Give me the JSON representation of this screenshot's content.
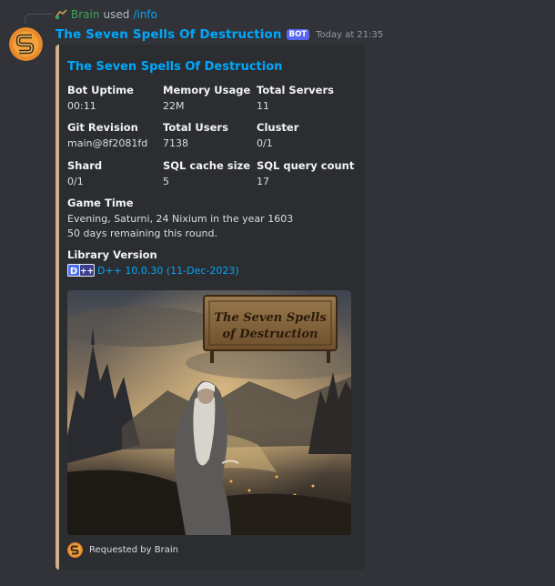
{
  "reply": {
    "user": "Brain",
    "used": "used",
    "command": "/info"
  },
  "message": {
    "username": "The Seven Spells Of Destruction",
    "bot_tag": "BOT",
    "timestamp": "Today at 21:35"
  },
  "embed": {
    "accent_color": "#ceb18a",
    "title": "The Seven Spells Of Destruction",
    "fields": [
      {
        "name": "Bot Uptime",
        "value": "00:11"
      },
      {
        "name": "Memory Usage",
        "value": "22M"
      },
      {
        "name": "Total Servers",
        "value": "11"
      },
      {
        "name": "Git Revision",
        "value": "main@8f2081fd"
      },
      {
        "name": "Total Users",
        "value": "7138"
      },
      {
        "name": "Cluster",
        "value": "0/1"
      },
      {
        "name": "Shard",
        "value": "0/1"
      },
      {
        "name": "SQL cache size",
        "value": "5"
      },
      {
        "name": "SQL query count",
        "value": "17"
      }
    ],
    "game_time": {
      "name": "Game Time",
      "line1": "Evening, Saturni, 24 Nixium in the year 1603",
      "line2": "50 days remaining this round."
    },
    "library": {
      "name": "Library Version",
      "link": "D++ 10.0.30 (11-Dec-2023)"
    },
    "image_banner": {
      "line1": "The Seven Spells",
      "line2": "of Destruction"
    },
    "footer": {
      "text": "Requested by Brain"
    }
  }
}
